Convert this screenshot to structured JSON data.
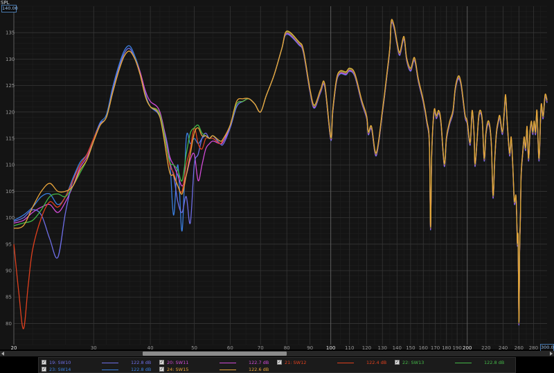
{
  "chart_data": {
    "type": "line",
    "title": "",
    "xlabel": "",
    "ylabel": "",
    "y_unit_label": "SPL",
    "x_scale": "log",
    "xlim": [
      20,
      300
    ],
    "ylim": [
      76,
      140
    ],
    "grid": true,
    "y_ticks": [
      80,
      85,
      90,
      95,
      100,
      105,
      110,
      115,
      120,
      125,
      130,
      135
    ],
    "y_max_label": "140.00",
    "x_ticks": [
      {
        "v": 20,
        "label": "20",
        "major": true
      },
      {
        "v": 30,
        "label": "30",
        "major": false
      },
      {
        "v": 40,
        "label": "40",
        "major": false
      },
      {
        "v": 50,
        "label": "50",
        "major": false
      },
      {
        "v": 60,
        "label": "60",
        "major": false
      },
      {
        "v": 70,
        "label": "70",
        "major": false
      },
      {
        "v": 80,
        "label": "80",
        "major": false
      },
      {
        "v": 90,
        "label": "90",
        "major": false
      },
      {
        "v": 100,
        "label": "100",
        "major": true
      },
      {
        "v": 110,
        "label": "110",
        "major": false
      },
      {
        "v": 120,
        "label": "120",
        "major": false
      },
      {
        "v": 130,
        "label": "130",
        "major": false
      },
      {
        "v": 140,
        "label": "140",
        "major": false
      },
      {
        "v": 150,
        "label": "150",
        "major": false
      },
      {
        "v": 160,
        "label": "160",
        "major": false
      },
      {
        "v": 170,
        "label": "170",
        "major": false
      },
      {
        "v": 180,
        "label": "180",
        "major": false
      },
      {
        "v": 190,
        "label": "190",
        "major": false
      },
      {
        "v": 200,
        "label": "200",
        "major": true
      },
      {
        "v": 220,
        "label": "220",
        "major": false
      },
      {
        "v": 240,
        "label": "240",
        "major": false
      },
      {
        "v": 260,
        "label": "260",
        "major": false
      },
      {
        "v": 280,
        "label": "280",
        "major": false
      }
    ],
    "x_max_label": "300.0",
    "common_x": [
      80,
      85,
      87,
      90,
      92,
      95,
      97,
      100,
      101,
      103,
      105,
      108,
      110,
      113,
      117,
      120,
      121,
      123,
      126,
      130,
      133,
      135,
      136,
      138,
      140,
      142,
      145,
      147,
      150,
      153,
      156,
      160,
      163,
      165,
      166,
      167,
      169,
      171,
      173,
      175,
      178,
      180,
      183,
      186,
      188,
      190,
      192,
      194,
      196,
      198,
      200,
      203,
      205,
      207,
      208,
      210,
      212,
      214,
      216,
      218,
      220,
      223,
      226,
      228,
      230,
      232,
      234,
      236,
      239,
      241,
      243,
      245,
      248,
      250,
      252,
      254,
      256,
      257,
      258,
      259,
      260,
      261,
      262,
      263,
      265,
      267,
      269,
      271,
      273,
      275,
      277,
      279,
      281,
      283,
      285,
      288,
      291,
      294,
      297,
      300
    ],
    "common_y": [
      135,
      133,
      131.5,
      124,
      121,
      124,
      125,
      115,
      120,
      126,
      127.5,
      127.3,
      128,
      127,
      122,
      119,
      116,
      117,
      112,
      120,
      127,
      132,
      137,
      136,
      133,
      131,
      134,
      130,
      128,
      130,
      126,
      122,
      118,
      114,
      98,
      112,
      120,
      119,
      120,
      118,
      110,
      115,
      118,
      120,
      124,
      126,
      126.5,
      125,
      122,
      119,
      118,
      114,
      120,
      116,
      110,
      114,
      119,
      120,
      118,
      111,
      116,
      118,
      114,
      104,
      111,
      116,
      118,
      119,
      116,
      119,
      123,
      118,
      112,
      115,
      110,
      103,
      104,
      101,
      95,
      96,
      80,
      94,
      100,
      108,
      112,
      115,
      113,
      117,
      111,
      116,
      118,
      116,
      118,
      116,
      120,
      111,
      121,
      119,
      123,
      122
    ],
    "series": [
      {
        "name": "19: SW10",
        "color": "#6f6fe8",
        "value_label": "122.8 dB",
        "x": [
          20,
          21,
          22,
          23,
          24,
          25,
          26,
          27,
          28,
          29,
          30,
          31,
          32,
          33,
          34,
          35,
          36,
          37,
          38,
          39,
          40,
          42,
          44,
          45,
          46,
          47,
          48,
          49,
          50,
          51,
          52,
          53,
          54,
          55,
          57,
          58,
          60,
          62,
          64,
          66,
          68,
          70,
          72,
          75,
          78
        ],
        "y": [
          99.3,
          100,
          101.5,
          100.5,
          96,
          92.5,
          101,
          107,
          110,
          112,
          115,
          117.8,
          119,
          124,
          128,
          131,
          132,
          130,
          127,
          123,
          121,
          119,
          111,
          108,
          103,
          101,
          104,
          99,
          110,
          112,
          115,
          116,
          115,
          115.5,
          114,
          114,
          117,
          121,
          122,
          122.5,
          121.5,
          120,
          123,
          127,
          132
        ]
      },
      {
        "name": "20: SW11",
        "color": "#d24cd8",
        "value_label": "122.7 dB",
        "x": [
          20,
          21,
          22,
          23,
          24,
          25,
          26,
          27,
          28,
          29,
          30,
          31,
          32,
          33,
          34,
          35,
          36,
          37,
          38,
          39,
          40,
          42,
          44,
          45,
          46,
          47,
          48,
          49,
          50,
          51,
          52,
          53,
          54,
          55,
          57,
          58,
          60,
          62,
          64,
          66,
          68,
          70,
          72,
          75,
          78
        ],
        "y": [
          99,
          99.5,
          101,
          102,
          102.5,
          101,
          103,
          106,
          109.5,
          111.5,
          114.5,
          117.5,
          119,
          123.5,
          127.5,
          130.5,
          131.5,
          130,
          127.5,
          124,
          122,
          120,
          112,
          110,
          108,
          106,
          108,
          111,
          112,
          107,
          110,
          113,
          114,
          114.5,
          114,
          114.5,
          117.5,
          121.5,
          122,
          122.5,
          121.5,
          120,
          123,
          127,
          132
        ]
      },
      {
        "name": "21: SW12",
        "color": "#e0401e",
        "value_label": "122.4 dB",
        "x": [
          20,
          20.5,
          21,
          21.5,
          22,
          23,
          24,
          25,
          26,
          27,
          28,
          29,
          30,
          31,
          32,
          33,
          34,
          35,
          36,
          37,
          38,
          39,
          40,
          42,
          44,
          45,
          46,
          47,
          48,
          49,
          50,
          51,
          52,
          53,
          54,
          55,
          57,
          58,
          60,
          62,
          64,
          66,
          68,
          70,
          72,
          75,
          78
        ],
        "y": [
          95,
          86,
          79,
          87,
          94,
          100,
          103,
          102,
          104,
          107,
          110,
          112,
          115,
          117.5,
          119,
          123.5,
          127.5,
          130.5,
          131.5,
          130,
          127,
          123,
          121,
          119.5,
          110.5,
          108.5,
          106,
          105,
          110,
          113,
          117,
          114,
          113,
          115,
          115,
          115,
          114,
          115,
          117.5,
          121.5,
          122,
          122.5,
          121.5,
          120,
          123,
          127,
          132
        ]
      },
      {
        "name": "22: SW13",
        "color": "#44b848",
        "value_label": "122.8 dB",
        "x": [
          20,
          21,
          22,
          23,
          24,
          25,
          26,
          27,
          28,
          29,
          30,
          31,
          32,
          33,
          34,
          35,
          36,
          37,
          38,
          39,
          40,
          42,
          44,
          45,
          46,
          47,
          48,
          49,
          50,
          51,
          52,
          53,
          54,
          55,
          57,
          58,
          60,
          62,
          64,
          66,
          68,
          70,
          72,
          75,
          78
        ],
        "y": [
          98.5,
          99,
          99.5,
          101.5,
          104,
          104.5,
          104,
          106,
          108.5,
          111,
          114.5,
          117.5,
          119,
          123.5,
          127.5,
          130.5,
          131.5,
          130,
          127,
          123,
          121,
          119.5,
          111,
          110,
          109,
          107,
          112,
          116,
          117,
          117.5,
          116,
          115.5,
          115,
          115.5,
          114.5,
          115,
          117.5,
          121.5,
          122,
          122.5,
          121.5,
          120,
          123,
          127,
          132
        ]
      },
      {
        "name": "23: SW14",
        "color": "#3a7fe0",
        "value_label": "122.8 dB",
        "x": [
          20,
          21,
          22,
          23,
          24,
          25,
          26,
          27,
          28,
          29,
          30,
          31,
          32,
          33,
          34,
          35,
          36,
          37,
          38,
          39,
          40,
          42,
          44,
          45,
          46,
          47,
          48,
          49,
          50,
          51,
          52,
          53,
          54,
          55,
          57,
          58,
          60,
          62,
          64,
          66,
          68,
          70,
          72,
          75,
          78
        ],
        "y": [
          99.5,
          100.5,
          102,
          104,
          104.5,
          102.5,
          104,
          107.5,
          110.5,
          112,
          115,
          118,
          119.5,
          124.5,
          128.5,
          131.5,
          132.5,
          130.5,
          127.5,
          123.5,
          121,
          119,
          112,
          100.5,
          110,
          97.5,
          115,
          114,
          115,
          114,
          115,
          115.5,
          115,
          115,
          114,
          114.5,
          117,
          121,
          122,
          122.5,
          121.5,
          120,
          123,
          127,
          132
        ]
      },
      {
        "name": "24: SW15",
        "color": "#e8a43a",
        "value_label": "122.6 dB",
        "x": [
          20,
          21,
          22,
          23,
          24,
          25,
          26,
          27,
          28,
          29,
          30,
          31,
          32,
          33,
          34,
          35,
          36,
          37,
          38,
          39,
          40,
          42,
          44,
          45,
          46,
          47,
          48,
          49,
          50,
          51,
          52,
          53,
          54,
          55,
          57,
          58,
          60,
          62,
          64,
          66,
          68,
          70,
          72,
          75,
          78
        ],
        "y": [
          98,
          98.5,
          102,
          105,
          106.5,
          105,
          105,
          106,
          109,
          111,
          114.5,
          117.5,
          119,
          123.5,
          127.5,
          130.5,
          131.5,
          130,
          127,
          123,
          121,
          119,
          109,
          108,
          106,
          104.5,
          108,
          112,
          116,
          117,
          115.5,
          115.5,
          115,
          115.5,
          114.5,
          115,
          117.5,
          122,
          122.5,
          122.5,
          121.5,
          120,
          123,
          127,
          132
        ]
      }
    ]
  },
  "ui": {
    "y_unit_label": "SPL",
    "y_max_label": "140.00",
    "x_max_label": "300.0"
  },
  "legend": [
    {
      "name": "19: SW10",
      "value": "122.8 dB",
      "color": "#6f6fe8",
      "checked": true
    },
    {
      "name": "20: SW11",
      "value": "122.7 dB",
      "color": "#d24cd8",
      "checked": true
    },
    {
      "name": "21: SW12",
      "value": "122.4 dB",
      "color": "#e0401e",
      "checked": true
    },
    {
      "name": "22: SW13",
      "value": "122.8 dB",
      "color": "#44b848",
      "checked": true
    },
    {
      "name": "23: SW14",
      "value": "122.8 dB",
      "color": "#3a7fe0",
      "checked": true
    },
    {
      "name": "24: SW15",
      "value": "122.6 dB",
      "color": "#e8a43a",
      "checked": true
    }
  ]
}
